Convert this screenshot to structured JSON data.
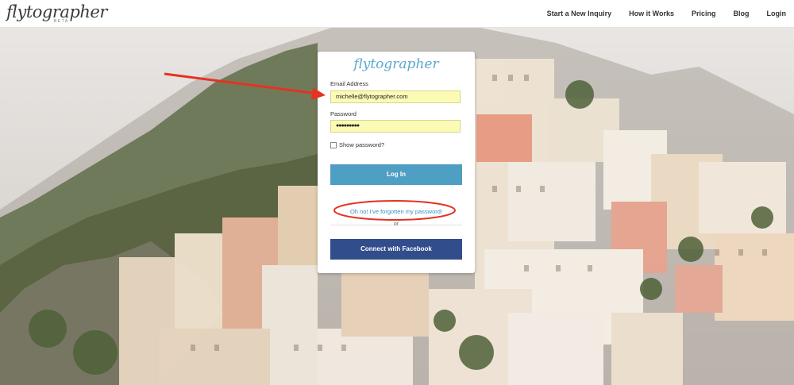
{
  "header": {
    "logo": "flytographer",
    "logo_badge": "BETA",
    "nav": [
      "Start a New Inquiry",
      "How it Works",
      "Pricing",
      "Blog",
      "Login"
    ]
  },
  "login": {
    "logo": "flytographer",
    "email_label": "Email Address",
    "email_value": "michelle@flytographer.com",
    "password_label": "Password",
    "password_value": "●●●●●●●●●",
    "show_password_label": "Show password?",
    "login_button": "Log In",
    "forgot_link": "Oh no! I've forgotten my password!",
    "or_text": "or",
    "facebook_button": "Connect with Facebook"
  },
  "colors": {
    "login_button": "#4e9fc3",
    "facebook_button": "#314d8c",
    "field_autofill": "#fbfbb6",
    "annotation": "#e53222"
  }
}
